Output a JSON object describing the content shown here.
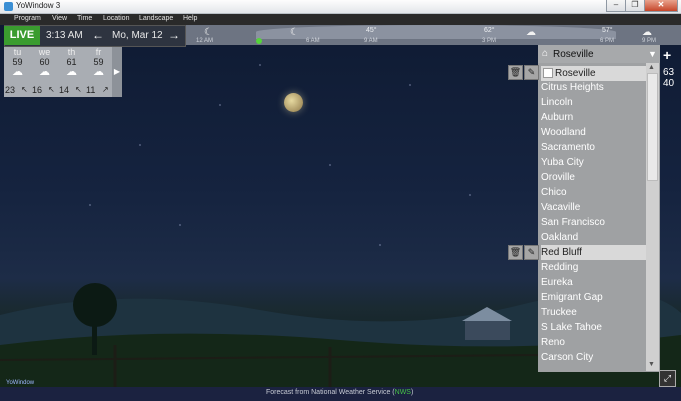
{
  "window": {
    "title": "YoWindow 3",
    "min": "–",
    "max": "❐",
    "close": "✕"
  },
  "menu": [
    "Program",
    "View",
    "Time",
    "Location",
    "Landscape",
    "Help"
  ],
  "toolbar": {
    "live": "LIVE",
    "time": "3:13 AM",
    "date": "Mo, Mar 12",
    "back": "←",
    "forward": "→"
  },
  "timeline": {
    "labels": [
      "12 AM",
      "6 AM",
      "9 AM",
      "3 PM",
      "6 PM",
      "9 PM"
    ],
    "temps": [
      "45°",
      "62°",
      "57°"
    ]
  },
  "forecast": [
    {
      "day": "tu",
      "temp": "59",
      "low": "23",
      "wind": "↖"
    },
    {
      "day": "we",
      "temp": "60",
      "low": "16",
      "wind": "↖"
    },
    {
      "day": "th",
      "temp": "61",
      "low": "14",
      "wind": "↖"
    },
    {
      "day": "fr",
      "temp": "59",
      "low": "11",
      "wind": "↗"
    }
  ],
  "forecast_next": "▶",
  "city_panel": {
    "current": "Roseville",
    "dropdown": "▼",
    "cities": [
      "Roseville",
      "Citrus Heights",
      "Lincoln",
      "Auburn",
      "Woodland",
      "Sacramento",
      "Yuba City",
      "Oroville",
      "Chico",
      "Vacaville",
      "San Francisco",
      "Oakland",
      "Red Bluff",
      "Redding",
      "Eureka",
      "Emigrant Gap",
      "Truckee",
      "S Lake Tahoe",
      "Reno",
      "Carson City"
    ],
    "selected": [
      "Roseville",
      "Red Bluff"
    ]
  },
  "side_temps": [
    "63",
    "40"
  ],
  "footer": {
    "prefix": "Forecast from National Weather Service (",
    "nws": "NWS",
    "suffix": ")"
  },
  "brand": "YoWindow",
  "colors": {
    "live": "#3a9c2f",
    "nws_link": "#46c246"
  }
}
